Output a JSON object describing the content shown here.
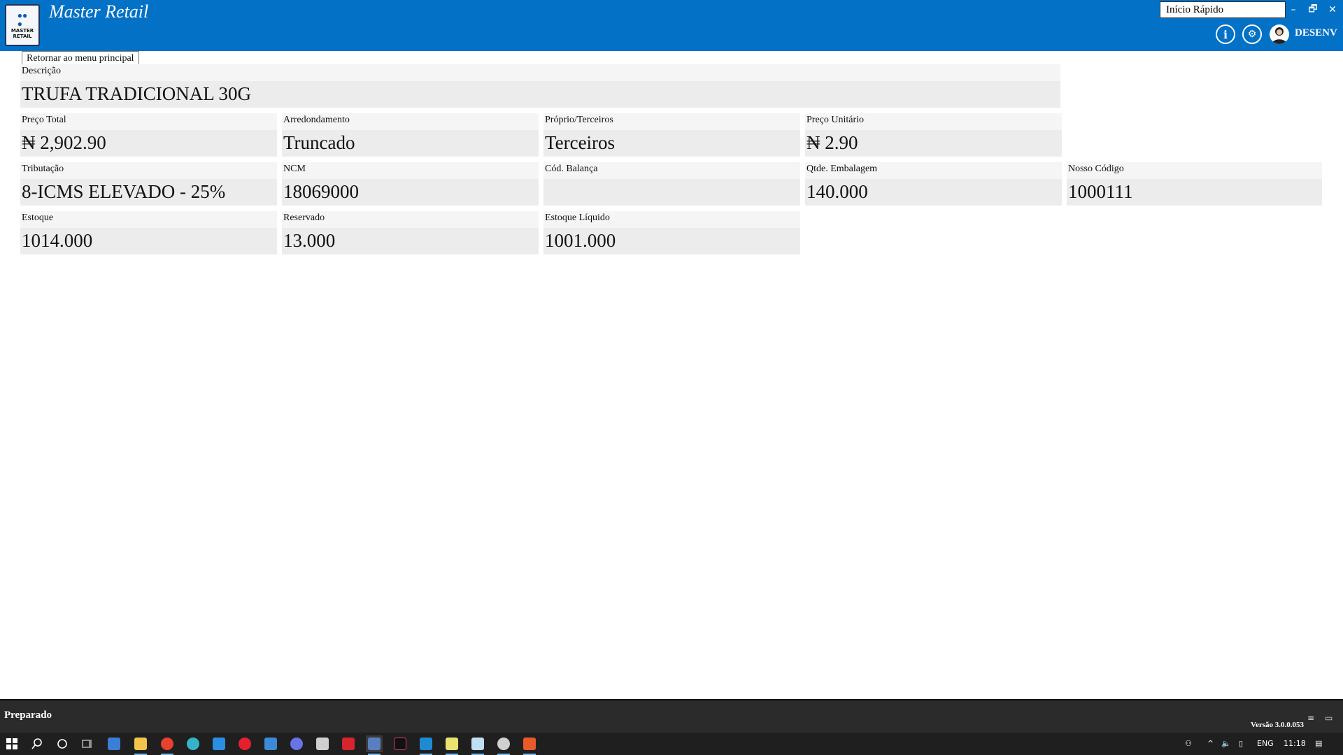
{
  "app": {
    "title": "Master Retail",
    "logo_text": "MASTER RETAIL",
    "quick_start": "Início Rápido",
    "user": "DESENV",
    "tooltip": "Retornar ao menu principal"
  },
  "window_controls": {
    "minimize": "–",
    "restore": "🗗",
    "close": "✕"
  },
  "header_buttons": {
    "info_icon": "i",
    "settings_icon": "⚙"
  },
  "fields": {
    "descricao": {
      "label": "Descrição",
      "value": "TRUFA TRADICIONAL 30G"
    },
    "preco_total": {
      "label": "Preço Total",
      "value": "₦ 2,902.90"
    },
    "arredondamento": {
      "label": "Arredondamento",
      "value": "Truncado"
    },
    "proprio_terceiros": {
      "label": "Próprio/Terceiros",
      "value": "Terceiros"
    },
    "preco_unitario": {
      "label": "Preço Unitário",
      "value": "₦ 2.90"
    },
    "tributacao": {
      "label": "Tributação",
      "value": "8-ICMS ELEVADO - 25%"
    },
    "ncm": {
      "label": "NCM",
      "value": "18069000"
    },
    "cod_balanca": {
      "label": "Cód. Balança",
      "value": ""
    },
    "qtde_embalagem": {
      "label": "Qtde. Embalagem",
      "value": "140.000"
    },
    "nosso_codigo": {
      "label": "Nosso Código",
      "value": "1000111"
    },
    "estoque": {
      "label": "Estoque",
      "value": "1014.000"
    },
    "reservado": {
      "label": "Reservado",
      "value": "13.000"
    },
    "estoque_liquido": {
      "label": "Estoque Líquido",
      "value": "1001.000"
    }
  },
  "status": {
    "text": "Preparado",
    "version": "Versão 3.0.0.053"
  },
  "taskbar": {
    "language": "ENG",
    "time": "11:18",
    "colors": {
      "accent": "#0271c6",
      "statusbar": "#2b2b2b",
      "taskbar": "#1f1f1f"
    }
  }
}
